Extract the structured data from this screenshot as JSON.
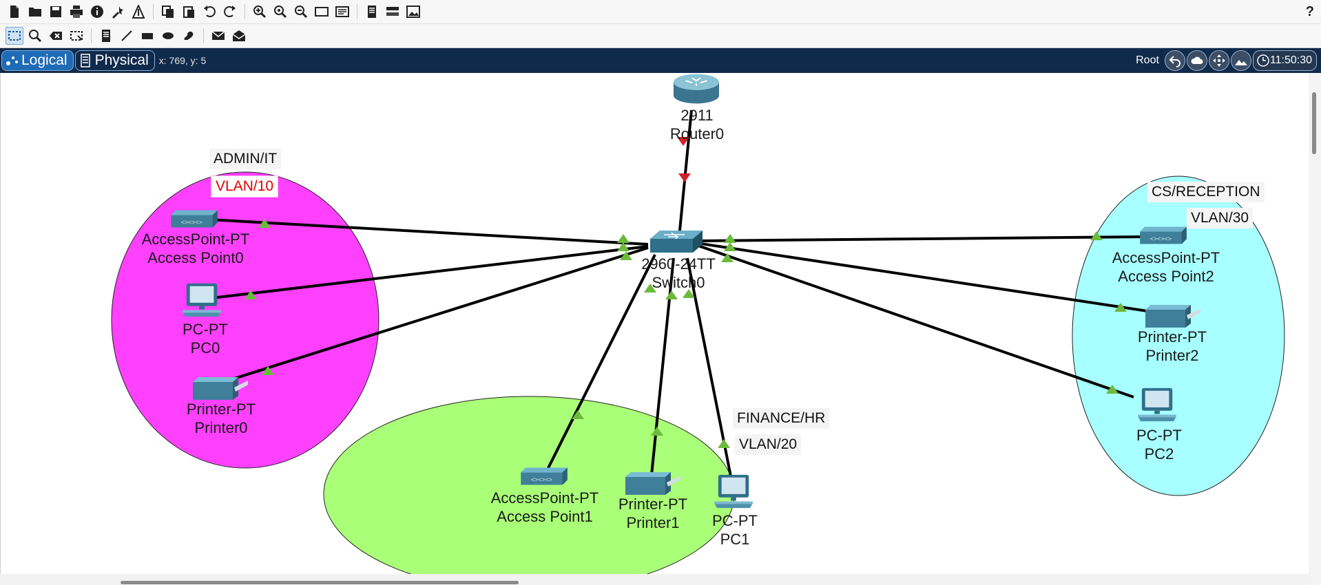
{
  "toolbar_main": {
    "icons": [
      "new-file-icon",
      "open-folder-icon",
      "save-icon",
      "print-icon",
      "info-icon",
      "activity-wizard-icon",
      "custom-device-icon",
      "copy-icon",
      "paste-icon",
      "undo-icon",
      "redo-icon",
      "zoom-in-icon",
      "zoom-reset-icon",
      "zoom-out-icon",
      "drawing-palette-icon",
      "custom-devices-dialog-icon",
      "pdu-viewer-icon",
      "cluster-icon",
      "image-icon"
    ],
    "help": "?"
  },
  "toolbar_tools": {
    "icons": [
      "select-icon",
      "inspect-icon",
      "delete-icon",
      "resize-icon",
      "note-icon",
      "line-icon",
      "rectangle-icon",
      "ellipse-icon",
      "freeform-icon",
      "add-simple-pdu-icon",
      "add-complex-pdu-icon"
    ]
  },
  "view_bar": {
    "tab_logical": "Logical",
    "tab_physical": "Physical",
    "coords": "x: 769, y: 5",
    "root_label": "Root",
    "clock": "11:50:30"
  },
  "colors": {
    "admin_zone": "#ff40ff",
    "finance_zone": "#aaff78",
    "cs_zone": "#a8ffff",
    "link": "#000000",
    "link_up": "#6cba3c",
    "link_down": "#d0202a"
  },
  "zones": {
    "admin_title": "ADMIN/IT",
    "admin_vlan": "VLAN/10",
    "finance_title": "FINANCE/HR",
    "finance_vlan": "VLAN/20",
    "cs_title": "CS/RECEPTION",
    "cs_vlan": "VLAN/30"
  },
  "devices": {
    "router": {
      "model": "2911",
      "name": "Router0",
      "icon": "router-icon"
    },
    "switch": {
      "model": "2960-24TT",
      "name": "Switch0",
      "icon": "switch-icon"
    },
    "ap0": {
      "model": "AccessPoint-PT",
      "name": "Access Point0",
      "icon": "access-point-icon"
    },
    "pc0": {
      "model": "PC-PT",
      "name": "PC0",
      "icon": "pc-icon"
    },
    "printer0": {
      "model": "Printer-PT",
      "name": "Printer0",
      "icon": "printer-icon"
    },
    "ap1": {
      "model": "AccessPoint-PT",
      "name": "Access Point1",
      "icon": "access-point-icon"
    },
    "printer1": {
      "model": "Printer-PT",
      "name": "Printer1",
      "icon": "printer-icon"
    },
    "pc1": {
      "model": "PC-PT",
      "name": "PC1",
      "icon": "pc-icon"
    },
    "ap2": {
      "model": "AccessPoint-PT",
      "name": "Access Point2",
      "icon": "access-point-icon"
    },
    "printer2": {
      "model": "Printer-PT",
      "name": "Printer2",
      "icon": "printer-icon"
    },
    "pc2": {
      "model": "PC-PT",
      "name": "PC2",
      "icon": "pc-icon"
    }
  }
}
